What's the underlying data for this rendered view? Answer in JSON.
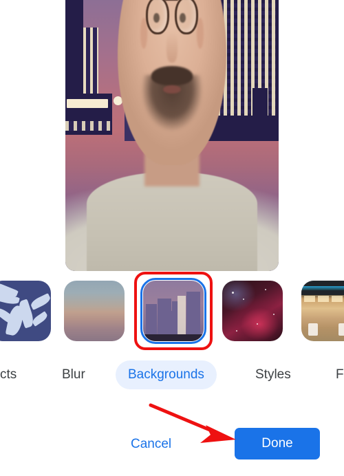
{
  "app": {
    "screen_name": "video-background-picker",
    "accent_color": "#1a73e8",
    "active_pill_bg": "#e8f0fe",
    "annotation_color": "#ee1111"
  },
  "preview": {
    "label": "self-view-video-preview",
    "applied_background": "City Skyline at Dusk"
  },
  "thumbnails": [
    {
      "name": "fern-pattern-background",
      "label": "Ferns",
      "selected": false,
      "clipped": true
    },
    {
      "name": "sunset-gradient-background",
      "label": "Sunset Haze",
      "selected": false,
      "clipped": false
    },
    {
      "name": "city-skyline-background",
      "label": "City Skyline",
      "selected": true,
      "clipped": false
    },
    {
      "name": "nebula-space-background",
      "label": "Red Nebula",
      "selected": false,
      "clipped": false
    },
    {
      "name": "patio-lights-background",
      "label": "Patio Lights",
      "selected": false,
      "clipped": true
    }
  ],
  "tabs": [
    {
      "id": "effects",
      "label": "cts",
      "active": false,
      "clipped": true
    },
    {
      "id": "blur",
      "label": "Blur",
      "active": false,
      "clipped": false
    },
    {
      "id": "backgrounds",
      "label": "Backgrounds",
      "active": true,
      "clipped": false
    },
    {
      "id": "styles",
      "label": "Styles",
      "active": false,
      "clipped": false
    },
    {
      "id": "filters",
      "label": "F",
      "active": false,
      "clipped": true
    }
  ],
  "footer": {
    "cancel_label": "Cancel",
    "done_label": "Done"
  },
  "annotations": {
    "arrow": {
      "name": "red-pointer-arrow",
      "points_to": "done-button"
    },
    "rect": {
      "name": "red-highlight-rect",
      "surrounds": "city-skyline-background"
    }
  }
}
